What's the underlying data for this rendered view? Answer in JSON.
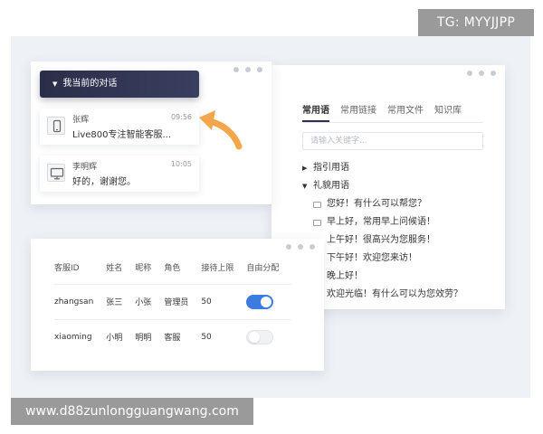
{
  "watermark_top": "TG: MYYJJPP",
  "watermark_bottom": "www.d88zunlongguangwang.com",
  "colors": {
    "accent": "#3d7be0",
    "header_dark": "#2a2e48",
    "arrow": "#f5a54a",
    "backdrop": "#eef1f6"
  },
  "conversations": {
    "header_label": "我当前的对话",
    "items": [
      {
        "name": "张辉",
        "time": "09:56",
        "message": "Live800专注智能客服...",
        "icon": "mobile-icon"
      },
      {
        "name": "李明辉",
        "time": "10:05",
        "message": "好的，谢谢您。",
        "icon": "desktop-icon"
      }
    ]
  },
  "phrases": {
    "tabs": [
      "常用语",
      "常用链接",
      "常用文件",
      "知识库"
    ],
    "active_tab": "常用语",
    "search_placeholder": "请输入关键字...",
    "groups": [
      {
        "label": "指引用语",
        "expanded": false
      },
      {
        "label": "礼貌用语",
        "expanded": true
      }
    ],
    "items": [
      "您好！有什么可以帮您？",
      "早上好，常用早上问候语！",
      "上午好！很高兴为您服务！",
      "下午好！欢迎您来访！",
      "晚上好！",
      "欢迎光临！有什么可以为您效劳？"
    ]
  },
  "agents_table": {
    "headers": [
      "客服ID",
      "姓名",
      "昵称",
      "角色",
      "接待上限",
      "自由分配"
    ],
    "rows": [
      {
        "id": "zhangsan",
        "name": "张三",
        "nickname": "小张",
        "role": "管理员",
        "limit": "50",
        "auto_assign": true
      },
      {
        "id": "xiaoming",
        "name": "小明",
        "nickname": "明明",
        "role": "客服",
        "limit": "50",
        "auto_assign": false
      }
    ]
  }
}
